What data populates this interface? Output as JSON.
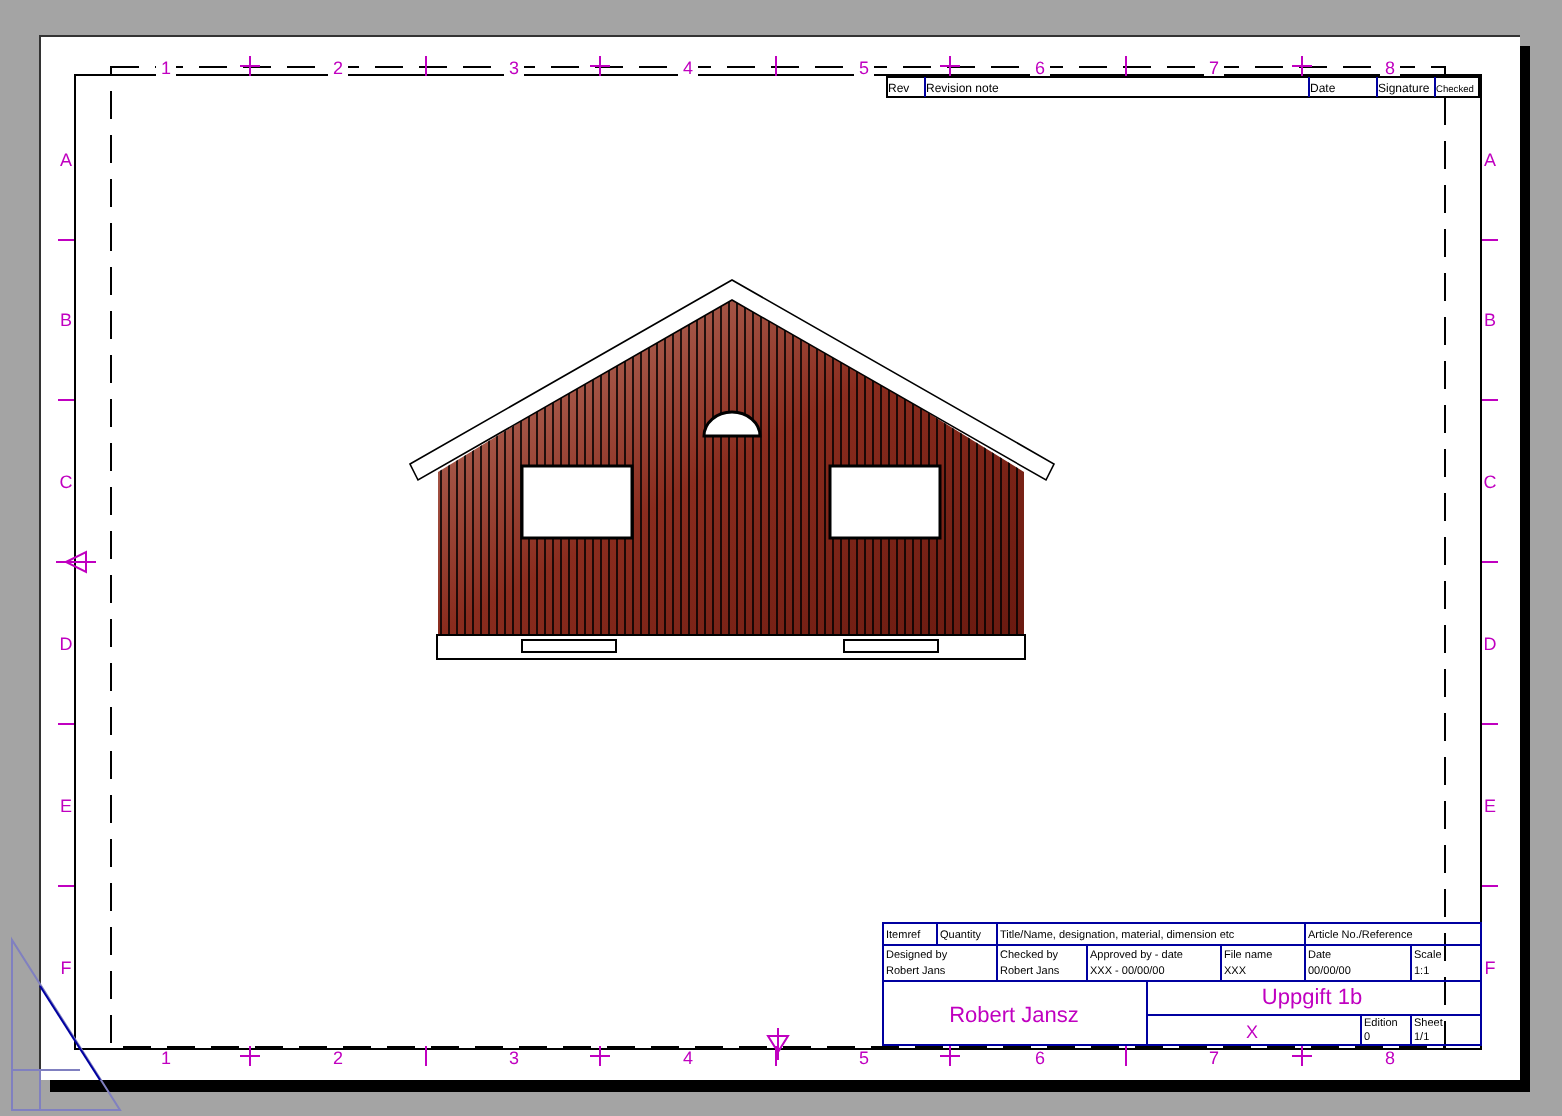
{
  "sheet": {
    "top_zone_labels": [
      "1",
      "2",
      "3",
      "4",
      "5",
      "6",
      "7",
      "8"
    ],
    "bottom_zone_labels": [
      "1",
      "2",
      "3",
      "4",
      "5",
      "6",
      "7",
      "8"
    ],
    "left_zone_labels": [
      "A",
      "B",
      "C",
      "D",
      "E",
      "F"
    ],
    "right_zone_labels": [
      "A",
      "B",
      "C",
      "D",
      "E",
      "F"
    ]
  },
  "revision_table": {
    "columns": [
      "Rev",
      "Revision note",
      "Date",
      "Signature",
      "Checked"
    ]
  },
  "title_block": {
    "row_1": [
      {
        "label": "Itemref"
      },
      {
        "label": "Quantity"
      },
      {
        "label": "Title/Name, designation, material, dimension etc"
      },
      {
        "label": "Article No./Reference"
      }
    ],
    "row_2": [
      {
        "label": "Designed by",
        "value": "Robert Jans"
      },
      {
        "label": "Checked by",
        "value": "Robert Jans"
      },
      {
        "label": "Approved by - date",
        "value": "XXX - 00/00/00"
      },
      {
        "label": "File name",
        "value": "XXX"
      },
      {
        "label": "Date",
        "value": "00/00/00"
      },
      {
        "label": "Scale",
        "value": "1:1"
      }
    ],
    "author": "Robert Jansz",
    "title": "Uppgift 1b",
    "subtitle": "X",
    "edition": {
      "label": "Edition",
      "value": "0"
    },
    "sheet_no": {
      "label": "Sheet",
      "value": "1/1"
    }
  }
}
